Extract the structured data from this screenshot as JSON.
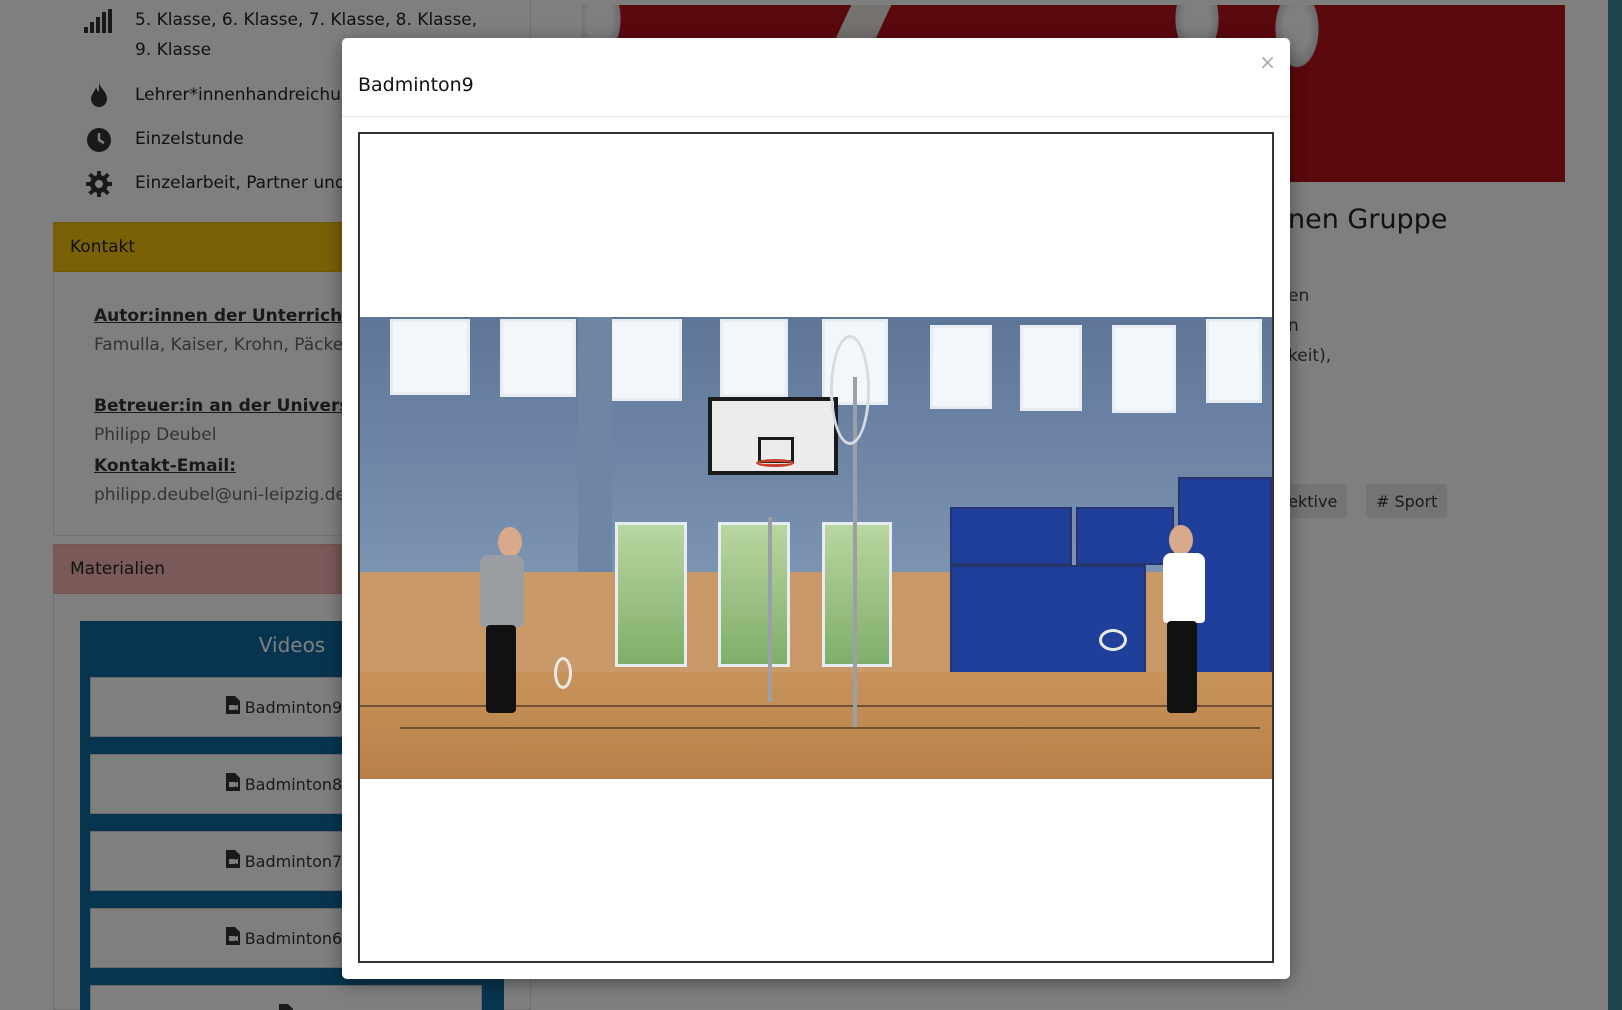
{
  "sidebar": {
    "meta": [
      {
        "icon": "signal-bars-icon",
        "text": "5. Klasse, 6. Klasse, 7. Klasse, 8. Klasse,"
      },
      {
        "icon": "signal-bars-icon",
        "text": "9. Klasse"
      },
      {
        "icon": "fire-icon",
        "text": "Lehrer*innenhandreichu"
      },
      {
        "icon": "clock-icon",
        "text": "Einzelstunde"
      },
      {
        "icon": "gear-icon",
        "text": "Einzelarbeit, Partner und"
      }
    ],
    "kontakt": {
      "heading": "Kontakt",
      "authors_label": "Autor:innen der Unterrichtsid",
      "authors_value": "Famulla, Kaiser, Krohn, Päcke",
      "supervisor_label": "Betreuer:in an der  Universit",
      "supervisor_value": "Philipp Deubel",
      "email_label": "Kontakt-Email:",
      "email_value": "philipp.deubel@uni-leipzig.de"
    },
    "materialien": {
      "heading": "Materialien",
      "videos_title": "Videos",
      "items": [
        "Badminton9.",
        "Badminton8.",
        "Badminton7.",
        "Badminton6."
      ]
    }
  },
  "main": {
    "title_fragment": "nen Gruppe",
    "text_fragments": [
      "en",
      "n",
      "keit),"
    ],
    "tags": [
      "pektive",
      "# Sport"
    ]
  },
  "modal": {
    "title": "Badminton9",
    "close_label": "×"
  },
  "colors": {
    "kontakt_header": "#f4c20d",
    "materialien_header": "#f4b4b0",
    "videos_box": "#0e6aa0",
    "hero": "#b5121b",
    "right_accent": "#3a8a94"
  }
}
